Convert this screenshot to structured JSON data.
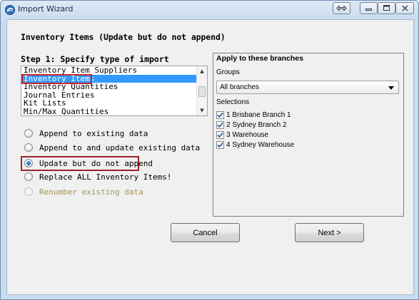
{
  "window": {
    "title": "Import Wizard"
  },
  "heading": "Inventory Items (Update but do not append)",
  "step1": {
    "label": "Step 1:  Specify type of import",
    "items": [
      "Inventory Item Suppliers",
      "Inventory Items",
      "Inventory Quantities",
      "Journal Entries",
      "Kit Lists",
      "Min/Max Quantities"
    ],
    "selected_item": "Inventory Items"
  },
  "options": [
    {
      "label": "Append to existing data",
      "checked": false,
      "enabled": true
    },
    {
      "label": "Append to and update existing data",
      "checked": false,
      "enabled": true
    },
    {
      "label": "Update but do not append",
      "checked": true,
      "enabled": true
    },
    {
      "label": "Replace ALL Inventory Items!",
      "checked": false,
      "enabled": true
    },
    {
      "label": "Renumber existing data",
      "checked": false,
      "enabled": false
    }
  ],
  "branches": {
    "title": "Apply to these branches",
    "groups_label": "Groups",
    "group_value": "All branches",
    "selections_label": "Selections",
    "selections": [
      {
        "label": "1  Brisbane Branch 1",
        "checked": true
      },
      {
        "label": "2  Sydney Branch 2",
        "checked": true
      },
      {
        "label": "3  Warehouse",
        "checked": true
      },
      {
        "label": "4  Sydney Warehouse",
        "checked": true
      }
    ]
  },
  "buttons": {
    "cancel": "Cancel",
    "next": "Next >"
  },
  "colors": {
    "selection": "#3399ff",
    "highlight_border": "#c0282e",
    "disabled_text": "#a49458"
  }
}
